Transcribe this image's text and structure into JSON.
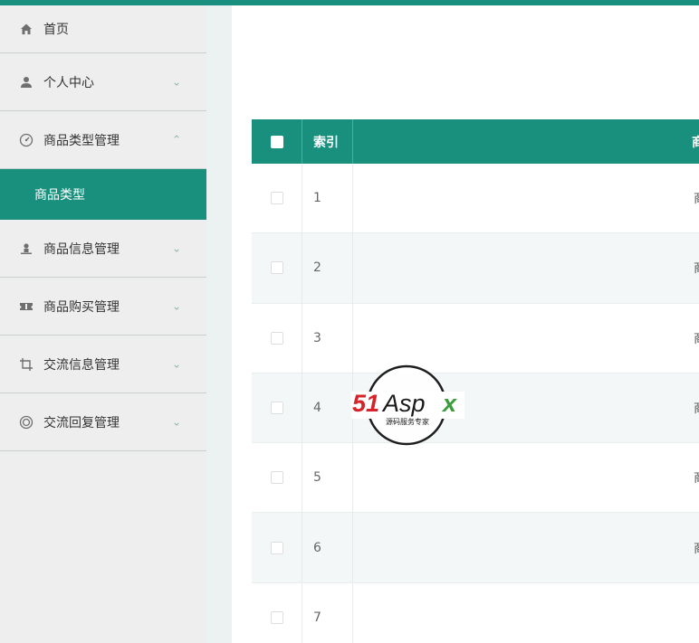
{
  "sidebar": {
    "items": [
      {
        "label": "首页",
        "icon": "home-icon"
      },
      {
        "label": "个人中心",
        "icon": "user-icon",
        "expanded": false
      },
      {
        "label": "商品类型管理",
        "icon": "gauge-icon",
        "expanded": true,
        "children": [
          {
            "label": "商品类型",
            "active": true
          }
        ]
      },
      {
        "label": "商品信息管理",
        "icon": "person-stand-icon",
        "expanded": false
      },
      {
        "label": "商品购买管理",
        "icon": "ticket-icon",
        "expanded": false
      },
      {
        "label": "交流信息管理",
        "icon": "crop-icon",
        "expanded": false
      },
      {
        "label": "交流回复管理",
        "icon": "target-icon",
        "expanded": false
      }
    ]
  },
  "table": {
    "headers": {
      "index": "索引",
      "name_partial": "商"
    },
    "rows": [
      {
        "index": "1",
        "name_partial": "商"
      },
      {
        "index": "2",
        "name_partial": "商"
      },
      {
        "index": "3",
        "name_partial": "商"
      },
      {
        "index": "4",
        "name_partial": "商"
      },
      {
        "index": "5",
        "name_partial": "商"
      },
      {
        "index": "6",
        "name_partial": "商"
      },
      {
        "index": "7",
        "name_partial": ""
      }
    ]
  },
  "watermark": {
    "brand": "51Aspx",
    "tagline": "源码服务专家"
  },
  "colors": {
    "accent": "#18907d",
    "sidebar_bg": "#eeeeee",
    "row_alt": "#f3f7f7"
  }
}
